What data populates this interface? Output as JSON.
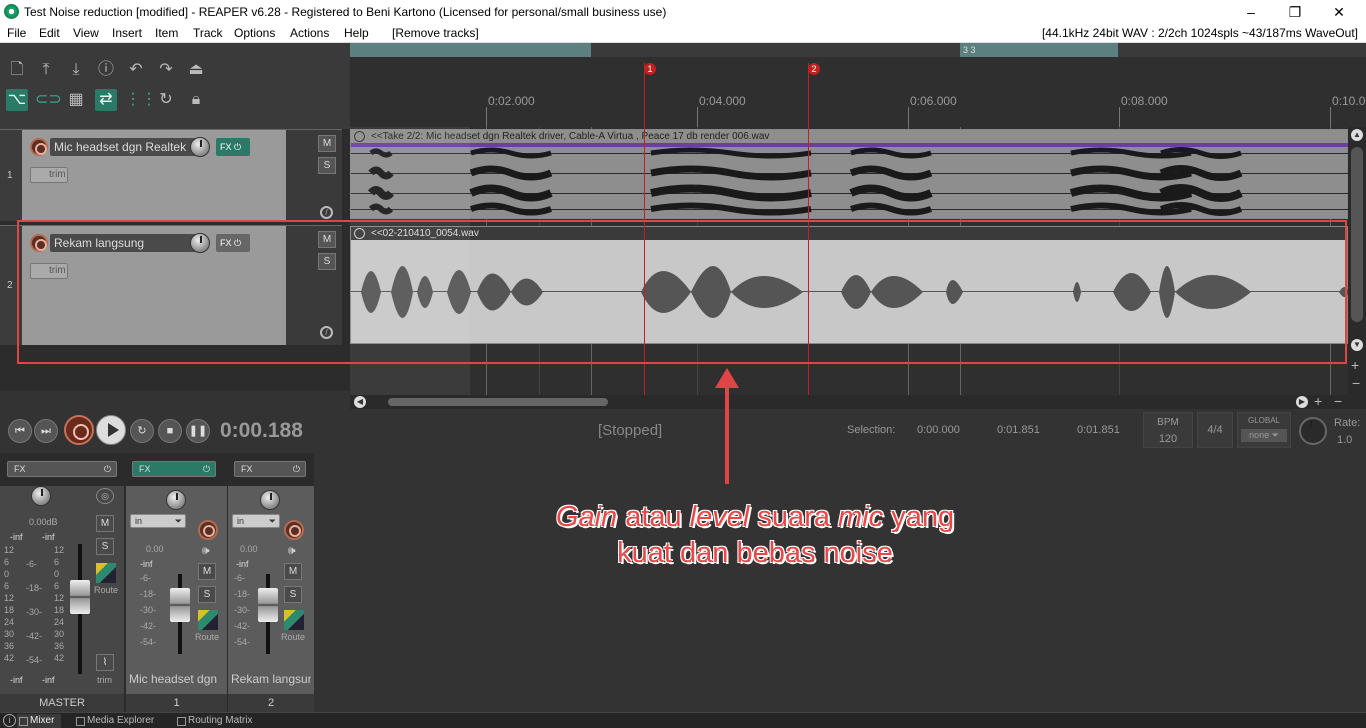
{
  "window": {
    "title": "Test Noise reduction [modified] - REAPER v6.28 - Registered to Beni Kartono (Licensed for personal/small business use)",
    "minimize": "–",
    "maximize": "❐",
    "close": "✕"
  },
  "menu": {
    "items": [
      "File",
      "Edit",
      "View",
      "Insert",
      "Item",
      "Track",
      "Options",
      "Actions",
      "Help",
      "[Remove tracks]"
    ],
    "status": "[44.1kHz 24bit WAV : 2/2ch 1024spls ~43/187ms WaveOut]"
  },
  "toolbar": {
    "icons": [
      "new-project-icon",
      "save-icon",
      "open-icon",
      "project-settings-icon",
      "undo-icon",
      "redo-icon",
      "metronome-icon",
      "ripple-edit-icon",
      "grouping-icon",
      "snap-grid-icon",
      "auto-crossfade-icon",
      "grid-lines-icon",
      "loop-icon",
      "lock-icon"
    ]
  },
  "ruler": {
    "region_label": "3  3",
    "ticks": [
      "0:02.000",
      "0:04.000",
      "0:06.000",
      "0:08.000",
      "0:10.000"
    ],
    "markers": [
      "1",
      "2"
    ]
  },
  "tracks": [
    {
      "number": "1",
      "name": "Mic headset dgn Realtek",
      "fx": "FX",
      "trim": "trim",
      "mute": "M",
      "solo": "S",
      "item_label": "<<Take 2/2: Mic headset dgn Realtek driver, Cable-A Virtua , Peace 17 db render 006.wav"
    },
    {
      "number": "2",
      "name": "Rekam langsung",
      "fx": "FX",
      "trim": "trim",
      "mute": "M",
      "solo": "S",
      "item_label": "<<02-210410_0054.wav"
    }
  ],
  "transport": {
    "time": "0:00.188",
    "state": "[Stopped]",
    "selection_label": "Selection:",
    "selection_start": "0:00.000",
    "selection_end": "0:01.851",
    "selection_length": "0:01.851",
    "bpm_label": "BPM",
    "bpm": "120",
    "timesig": "4/4",
    "global_label": "GLOBAL",
    "global_value": "none",
    "rate_label": "Rate:",
    "rate": "1.0"
  },
  "mixer": {
    "master": {
      "fx": "FX",
      "volume": "0.00dB",
      "peak_l": "-inf",
      "peak_r": "-inf",
      "mute": "M",
      "solo": "S",
      "route": "Route",
      "trim": "trim",
      "name": "MASTER",
      "scale_left": [
        "12",
        "6",
        "0",
        "6",
        "12",
        "18",
        "24",
        "30",
        "36",
        "42"
      ],
      "scale_mid": [
        "-6-",
        "-18-",
        "-30-",
        "-42-",
        "-54-"
      ],
      "scale_right": [
        "12",
        "6",
        "0",
        "6",
        "12",
        "18",
        "24",
        "30",
        "36",
        "42"
      ],
      "bottom_l": "-inf",
      "bottom_r": "-inf"
    },
    "strips": [
      {
        "fx": "FX",
        "input": "in",
        "volume": "0.00",
        "peak": "-inf",
        "scale": [
          "-6-",
          "-18-",
          "-30-",
          "-42-",
          "-54-"
        ],
        "mute": "M",
        "solo": "S",
        "route": "Route",
        "name": "Mic headset dgn",
        "number": "1"
      },
      {
        "fx": "FX",
        "input": "in",
        "volume": "0.00",
        "peak": "-inf",
        "scale": [
          "-6-",
          "-18-",
          "-30-",
          "-42-",
          "-54-"
        ],
        "mute": "M",
        "solo": "S",
        "route": "Route",
        "name": "Rekam langsung",
        "number": "2"
      }
    ]
  },
  "dock_tabs": [
    "Mixer",
    "Media Explorer",
    "Routing Matrix"
  ],
  "annotation": {
    "em1": "Gain",
    "t1": " atau ",
    "em2": "level",
    "t2": " suara ",
    "em3": "mic",
    "t3": " yang",
    "line2": "kuat dan bebas noise"
  },
  "colors": {
    "accent": "#2b7a68",
    "record": "#c87058",
    "marker": "#c02020",
    "annotation": "#e84848"
  }
}
